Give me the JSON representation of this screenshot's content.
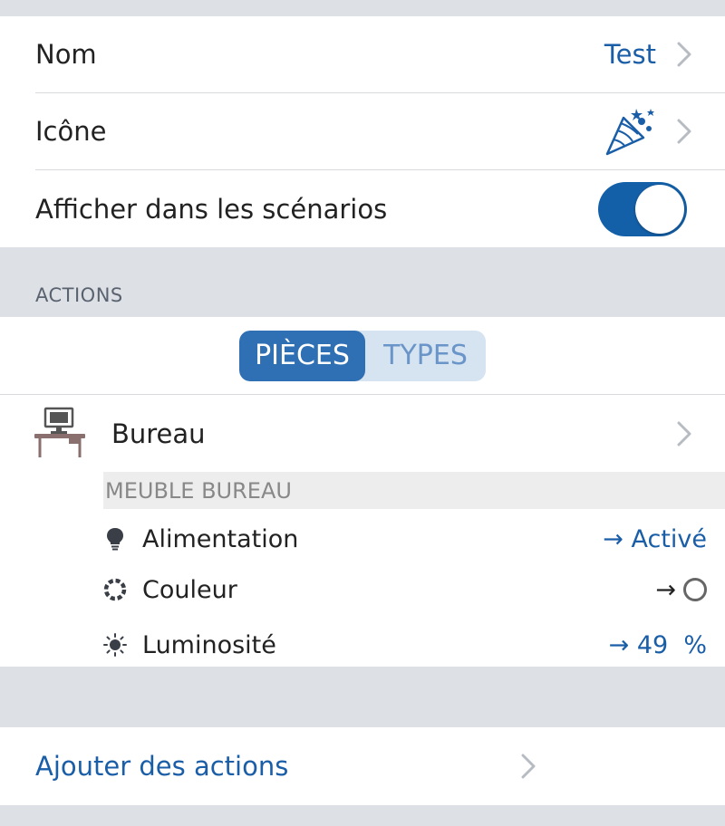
{
  "settings": {
    "name_label": "Nom",
    "name_value": "Test",
    "icon_label": "Icône",
    "show_label": "Afficher dans les scénarios",
    "show_enabled": true
  },
  "actions_header": "ACTIONS",
  "segments": {
    "rooms": "PIÈCES",
    "types": "TYPES",
    "selected": "rooms"
  },
  "room": {
    "name": "Bureau",
    "device": "MEUBLE BUREAU",
    "actions": [
      {
        "label": "Alimentation",
        "value": "→ Activé",
        "icon": "bulb-icon"
      },
      {
        "label": "Couleur",
        "value": "→",
        "icon": "color-wheel-icon"
      },
      {
        "label": "Luminosité",
        "value": "→ 49  %",
        "icon": "sun-icon"
      }
    ]
  },
  "add_actions": "Ajouter des actions",
  "colors": {
    "accent": "#1a5ea8",
    "toggle_on": "#1460a8",
    "segment_active": "#2f6fb3",
    "segment_bg": "#d6e3f1"
  }
}
